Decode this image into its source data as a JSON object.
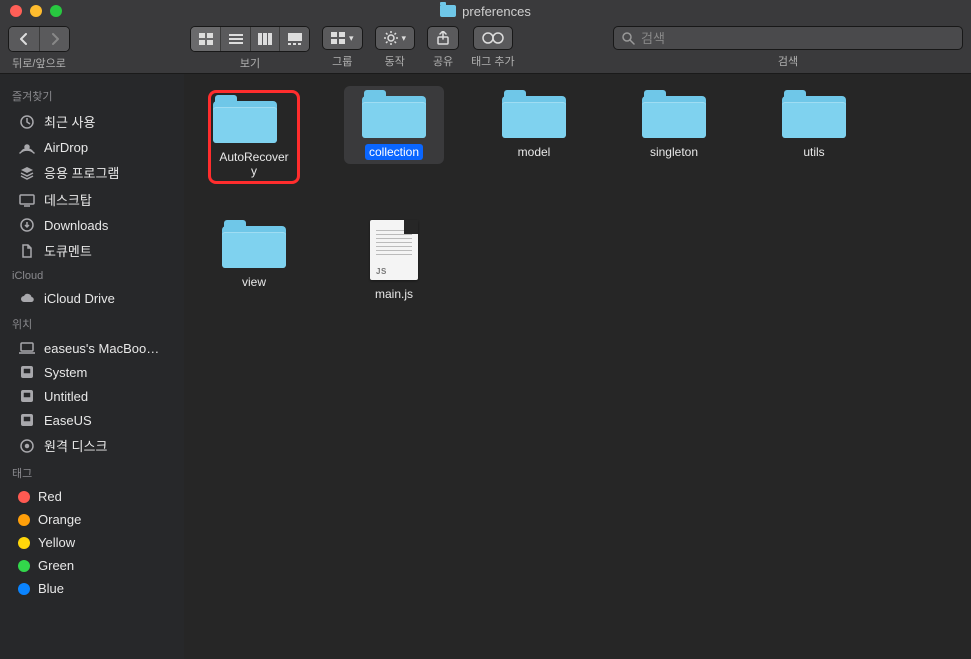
{
  "window": {
    "title": "preferences"
  },
  "toolbar": {
    "nav_label": "뒤로/앞으로",
    "view_label": "보기",
    "group_label": "그룹",
    "action_label": "동작",
    "share_label": "공유",
    "tags_label": "태그 추가",
    "search_label": "검색",
    "search_placeholder": "검색"
  },
  "sidebar": {
    "favorites_label": "즐겨찾기",
    "favorites": [
      {
        "label": "최근 사용",
        "icon": "clock"
      },
      {
        "label": "AirDrop",
        "icon": "airdrop"
      },
      {
        "label": "응용 프로그램",
        "icon": "apps"
      },
      {
        "label": "데스크탑",
        "icon": "desktop"
      },
      {
        "label": "Downloads",
        "icon": "downloads"
      },
      {
        "label": "도큐멘트",
        "icon": "documents"
      }
    ],
    "icloud_label": "iCloud",
    "icloud": [
      {
        "label": "iCloud Drive",
        "icon": "cloud"
      }
    ],
    "locations_label": "위치",
    "locations": [
      {
        "label": "easeus's MacBoo…",
        "icon": "laptop"
      },
      {
        "label": "System",
        "icon": "disk"
      },
      {
        "label": "Untitled",
        "icon": "disk"
      },
      {
        "label": "EaseUS",
        "icon": "disk"
      },
      {
        "label": "원격 디스크",
        "icon": "optical"
      }
    ],
    "tags_label": "태그",
    "tags": [
      {
        "label": "Red",
        "color": "#ff5a52"
      },
      {
        "label": "Orange",
        "color": "#ff9f0a"
      },
      {
        "label": "Yellow",
        "color": "#ffd60a"
      },
      {
        "label": "Green",
        "color": "#32d74b"
      },
      {
        "label": "Blue",
        "color": "#0a84ff"
      }
    ]
  },
  "content": {
    "items": [
      {
        "name": "AutoRecovery",
        "type": "folder",
        "highlighted": true
      },
      {
        "name": "collection",
        "type": "folder",
        "selected": true
      },
      {
        "name": "model",
        "type": "folder"
      },
      {
        "name": "singleton",
        "type": "folder"
      },
      {
        "name": "utils",
        "type": "folder"
      },
      {
        "name": "view",
        "type": "folder"
      },
      {
        "name": "main.js",
        "type": "js",
        "badge": "JS"
      }
    ]
  }
}
